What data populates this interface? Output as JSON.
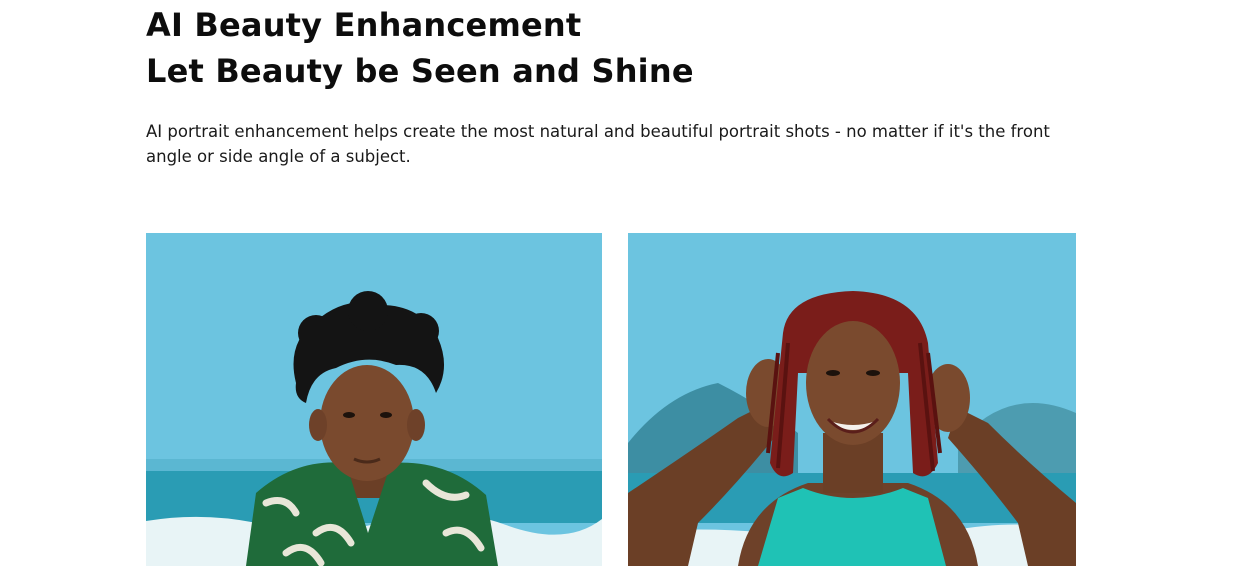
{
  "section": {
    "title_line1": "AI Beauty Enhancement",
    "title_line2": "Let Beauty be Seen and Shine",
    "description": "AI portrait enhancement helps create the most natural and beautiful portrait shots - no matter if it's the front angle or side angle of a subject."
  },
  "gallery": {
    "items": [
      {
        "icon": "portrait-photo-man-beach"
      },
      {
        "icon": "portrait-photo-woman-beach"
      }
    ]
  },
  "colors": {
    "sky": "#6cc4e0",
    "sea": "#2a9cb4",
    "surf": "#e8f4f6",
    "skin": "#7a4a2e",
    "hair": "#141414",
    "shirt_green": "#1f6b3a",
    "braids": "#7a1d1a",
    "top_teal": "#1fc2b5"
  }
}
